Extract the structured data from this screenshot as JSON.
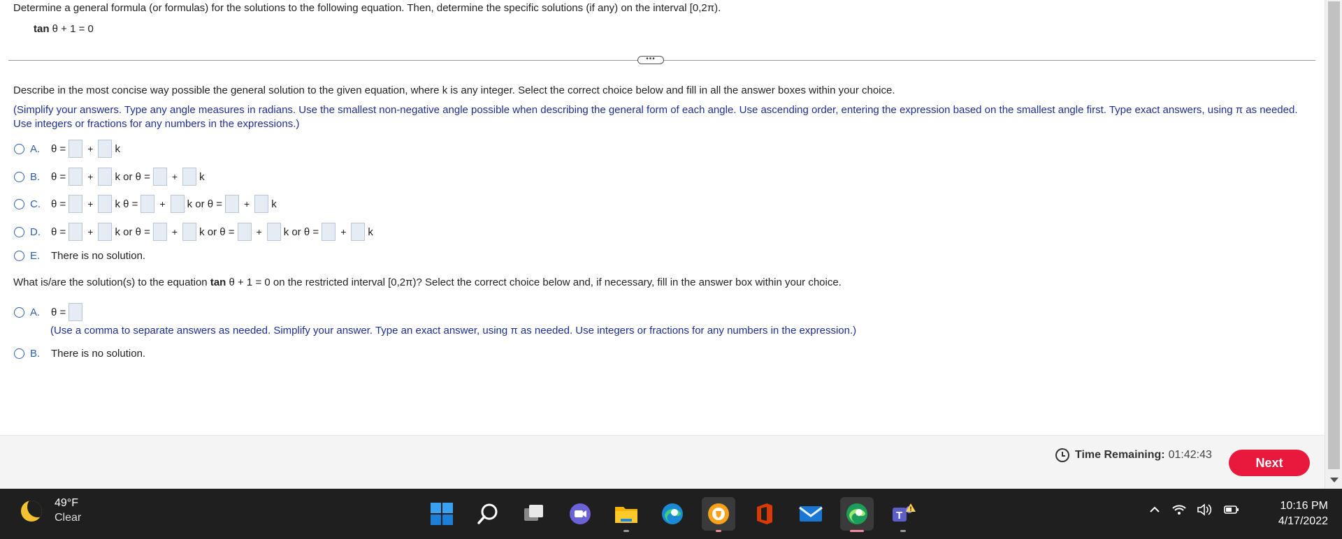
{
  "question": {
    "header": "Determine a general formula (or formulas) for the solutions to the following equation. Then, determine the specific solutions (if any) on the interval [0,2π).",
    "equation_func": "tan",
    "equation_rest": "θ + 1 = 0",
    "more_button": "•••"
  },
  "part1": {
    "instruction": "Describe in the most concise way possible the general solution to the given equation, where k is any integer. Select the correct choice below and fill in all the answer boxes within your choice.",
    "hint": "(Simplify your answers. Type any angle measures in radians. Use the smallest non-negative angle possible when describing the general form of each angle. Use ascending order, entering the expression based on the smallest angle first. Type exact answers, using π as needed. Use integers or fractions for any numbers in the expressions.)",
    "choices": [
      {
        "letter": "A.",
        "text": ""
      },
      {
        "letter": "B.",
        "text": ""
      },
      {
        "letter": "C.",
        "text": ""
      },
      {
        "letter": "D.",
        "text": ""
      },
      {
        "letter": "E.",
        "text": "There is no solution."
      }
    ],
    "tokens": {
      "theta_eq": "θ =",
      "plus": "+",
      "k": "k",
      "k_or": "k or θ =",
      "k_theta": "k θ ="
    }
  },
  "part2": {
    "question_pre": "What is/are the solution(s) to the equation ",
    "question_func": "tan",
    "question_post": " θ + 1 = 0 on the restricted interval [0,2π)? Select the correct choice below and, if necessary, fill in the answer box within your choice.",
    "choice_a_letter": "A.",
    "choice_a_eq": "θ =",
    "hint": "(Use a comma to separate answers as needed. Simplify your answer. Type an exact answer, using π as needed. Use integers or fractions for any numbers in the expression.)",
    "choice_b_letter": "B.",
    "choice_b_text": "There is no solution."
  },
  "footer": {
    "timer_label": "Time Remaining:",
    "timer_value": "01:42:43",
    "next_label": "Next"
  },
  "taskbar": {
    "temp": "49°F",
    "condition": "Clear",
    "time": "10:16 PM",
    "date": "4/17/2022",
    "icons": [
      "windows-start-icon",
      "search-icon",
      "task-view-icon",
      "chat-icon",
      "file-explorer-icon",
      "edge-icon",
      "brave-icon",
      "office-icon",
      "mail-icon",
      "edge-dev-icon",
      "teams-icon"
    ]
  },
  "colors": {
    "accent_blue": "#2e5fae",
    "hint_blue": "#1d2f8f",
    "next_red": "#e8193c"
  }
}
